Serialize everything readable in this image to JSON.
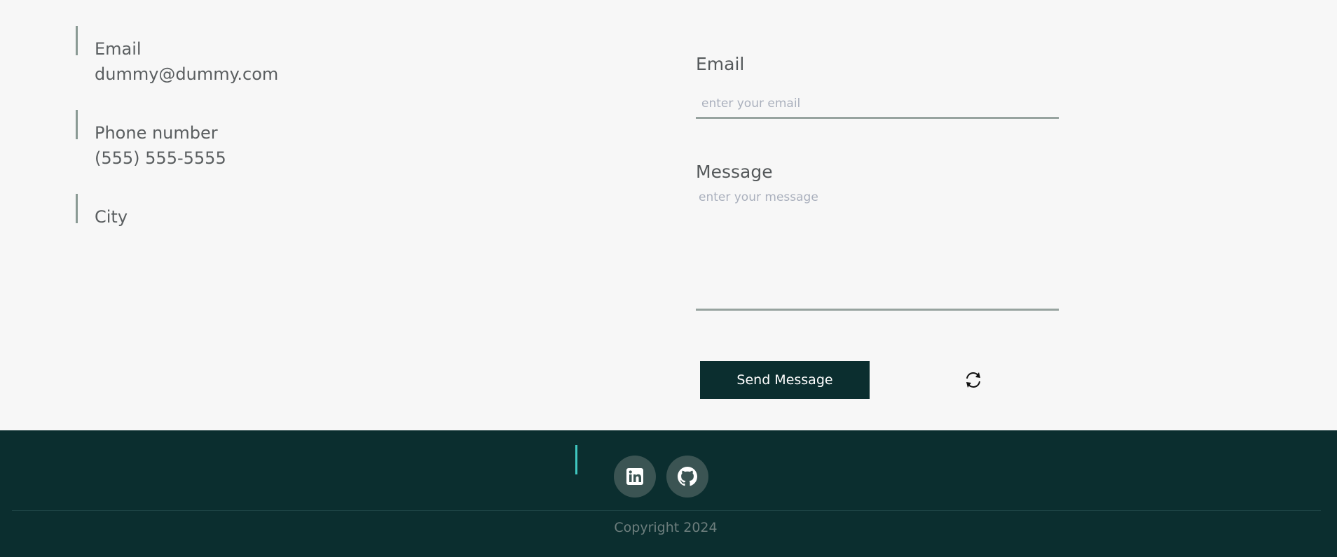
{
  "contact_info": {
    "email_label": "Email",
    "email_value": "dummy@dummy.com",
    "phone_label": "Phone number",
    "phone_value": "(555) 555-5555",
    "city_label": "City"
  },
  "form": {
    "email_label": "Email",
    "email_placeholder": "enter your email",
    "message_label": "Message",
    "message_placeholder": "enter your message",
    "send_label": "Send Message",
    "refresh_icon": "refresh-icon"
  },
  "footer": {
    "social_icons": [
      "linkedin-icon",
      "github-icon"
    ],
    "copyright": "Copyright 2024"
  },
  "colors": {
    "footer_bg": "#0b2e2f",
    "button_bg": "#0b2e2f",
    "accent_teal": "#3fc7c0",
    "page_bg": "#f7f7f7"
  }
}
